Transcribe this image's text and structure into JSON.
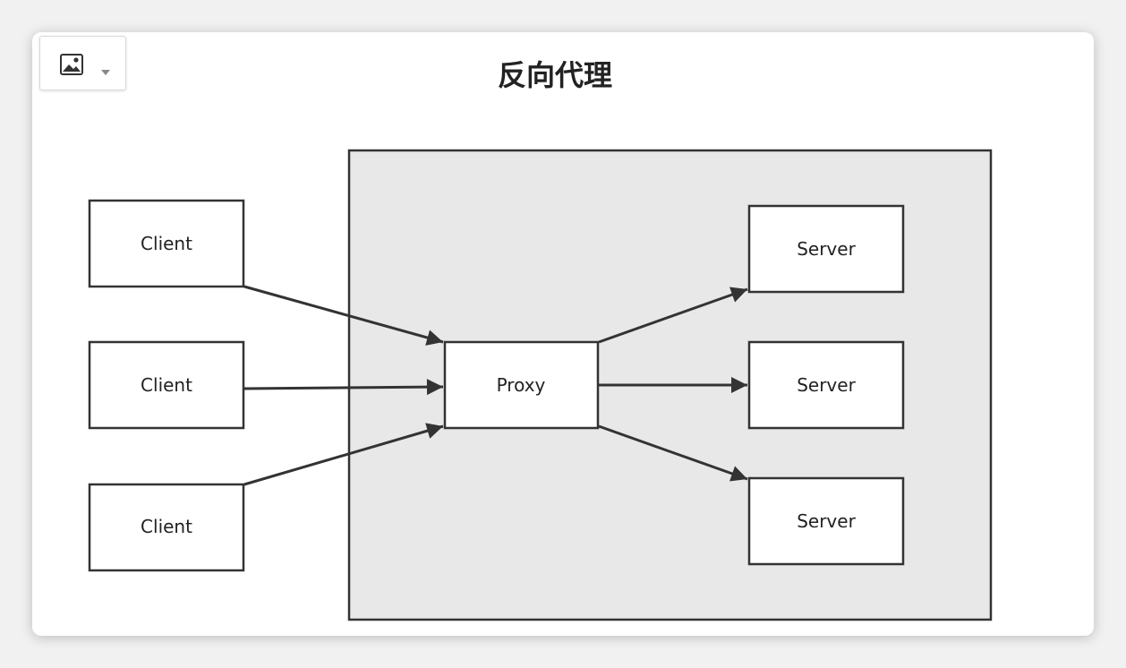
{
  "toolbar": {
    "image_button_icon": "image-icon",
    "dropdown_icon": "caret-down-icon"
  },
  "diagram": {
    "title": "反向代理",
    "clients": [
      "Client",
      "Client",
      "Client"
    ],
    "proxy": "Proxy",
    "servers": [
      "Server",
      "Server",
      "Server"
    ],
    "colors": {
      "region_fill": "#e8e8e8",
      "stroke": "#333333",
      "node_fill": "#ffffff"
    }
  }
}
